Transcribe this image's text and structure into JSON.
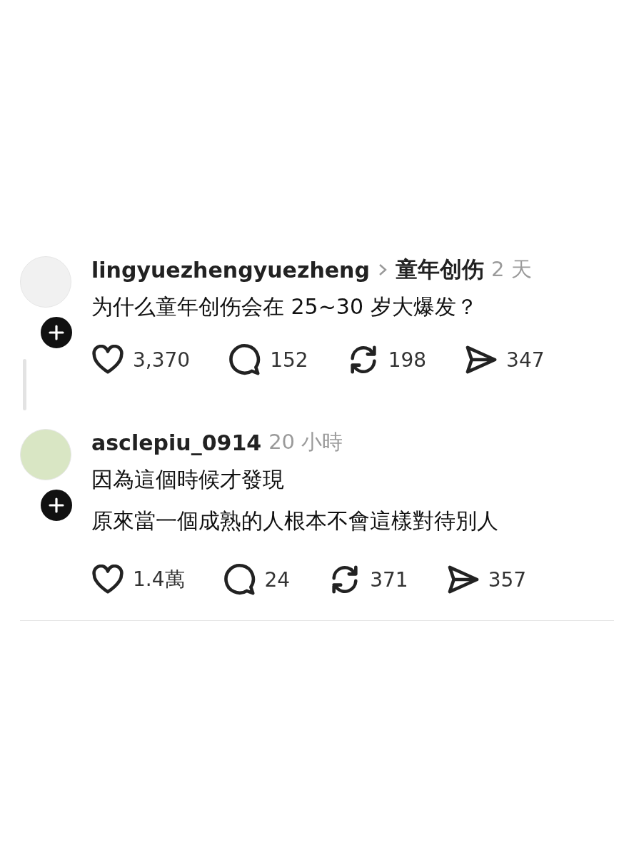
{
  "posts": [
    {
      "username": "lingyuezhengyuezheng",
      "topic": "童年创伤",
      "time": "2 天",
      "lines": [
        "为什么童年创伤会在 25~30 岁大爆发？"
      ],
      "thread_line": true,
      "stats": [
        {
          "kind": "like",
          "count": "3,370"
        },
        {
          "kind": "comment",
          "count": "152"
        },
        {
          "kind": "repost",
          "count": "198"
        },
        {
          "kind": "share",
          "count": "347"
        }
      ]
    },
    {
      "username": "asclepiu_0914",
      "time": "20 小時",
      "lines": [
        "因為這個時候才發現",
        "原來當一個成熟的人根本不會這樣對待別人"
      ],
      "thread_line": false,
      "stats": [
        {
          "kind": "like",
          "count": "1.4萬"
        },
        {
          "kind": "comment",
          "count": "24"
        },
        {
          "kind": "repost",
          "count": "371"
        },
        {
          "kind": "share",
          "count": "357"
        }
      ]
    }
  ]
}
